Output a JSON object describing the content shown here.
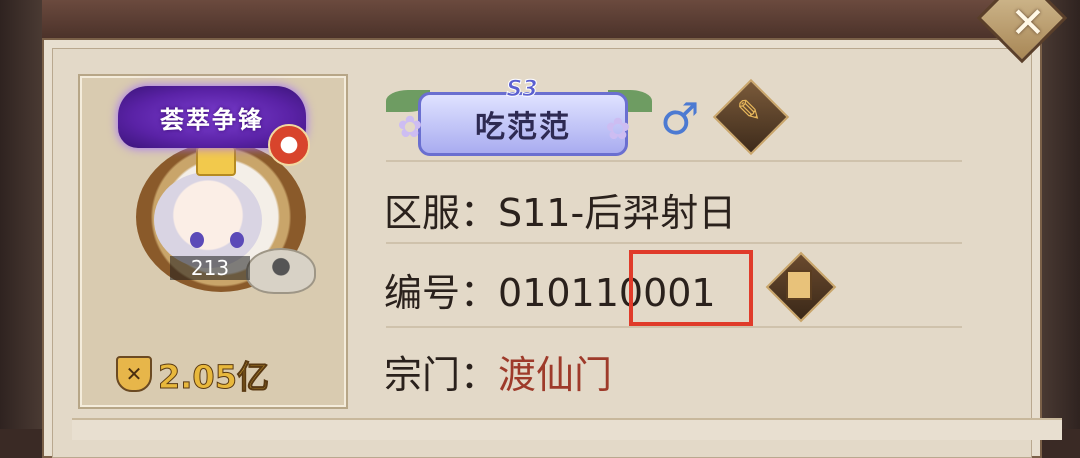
{
  "profile": {
    "badge_title": "荟萃争锋",
    "level": "213",
    "power": "2.05亿",
    "season": "S3",
    "name": "吃范范",
    "gender_symbol": "♂",
    "server_label": "区服：",
    "server_value": "S11-后羿射日",
    "id_label": "编号：",
    "id_value": "010110001",
    "sect_label": "宗门：",
    "sect_value": "渡仙门"
  },
  "icons": {
    "close": "close-icon",
    "copy": "copy-icon",
    "brush": "brush-icon",
    "power": "power-shield-icon"
  },
  "colors": {
    "highlight": "#e03b2a",
    "sect": "#9e3a2a",
    "power": "#e8b83c",
    "gender": "#4c7ad2"
  }
}
